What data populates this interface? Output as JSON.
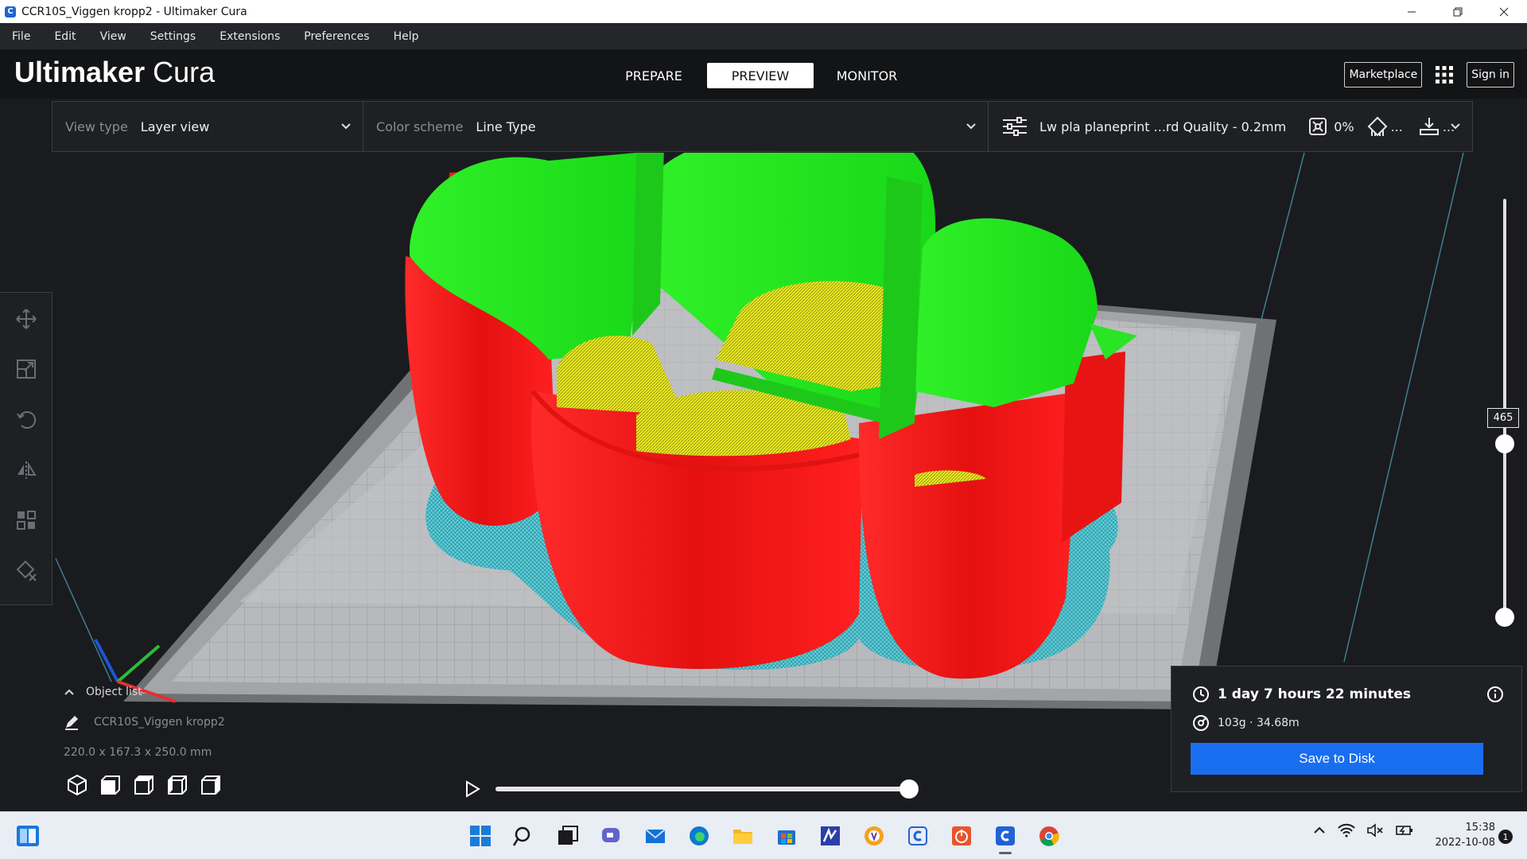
{
  "window": {
    "title": "CCR10S_Viggen kropp2 - Ultimaker Cura",
    "icon_name": "cura-app-icon"
  },
  "menu": [
    "File",
    "Edit",
    "View",
    "Settings",
    "Extensions",
    "Preferences",
    "Help"
  ],
  "brand": {
    "name_bold": "Ultimaker",
    "name_light": "Cura"
  },
  "stages": [
    {
      "label": "PREPARE",
      "active": false
    },
    {
      "label": "PREVIEW",
      "active": true
    },
    {
      "label": "MONITOR",
      "active": false
    }
  ],
  "header": {
    "marketplace": "Marketplace",
    "sign_in": "Sign in"
  },
  "toolbar": {
    "view_type_label": "View type",
    "view_type_value": "Layer view",
    "color_scheme_label": "Color scheme",
    "color_scheme_value": "Line Type",
    "profile": "Lw pla planeprint ...rd Quality - 0.2mm",
    "infill": "0%",
    "support_dots": "...",
    "adhesion_dots": "..."
  },
  "tools": [
    "move-icon",
    "scale-icon",
    "rotate-icon",
    "mirror-icon",
    "per-model-settings-icon",
    "support-blocker-icon"
  ],
  "object_list": {
    "toggle_label": "Object list",
    "object_name": "CCR10S_Viggen kropp2",
    "dimensions": "220.0 x 167.3 x 250.0 mm"
  },
  "layer_slider": {
    "current_layer": "465"
  },
  "simulation": {
    "progress": 1.0
  },
  "print_info": {
    "time": "1 day 7 hours 22 minutes",
    "material": "103g · 34.68m",
    "save_label": "Save to Disk"
  },
  "taskbar": {
    "time": "15:38",
    "date": "2022-10-08",
    "notifications": "1"
  },
  "colors": {
    "wall_outer": "#ff1a1a",
    "wall_inner": "#22e01e",
    "infill": "#e6e61a",
    "skirt": "#4ec9d8",
    "accent": "#196ef0"
  }
}
